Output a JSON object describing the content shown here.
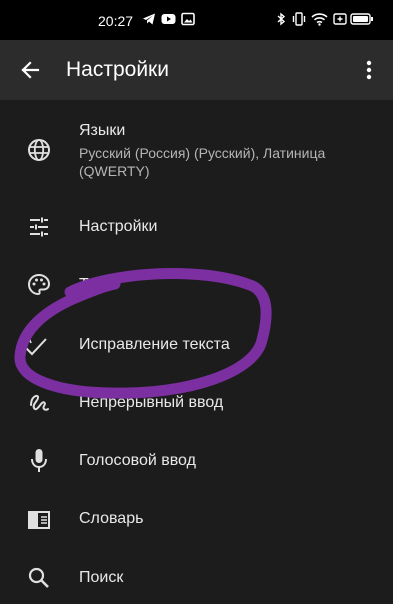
{
  "status_bar": {
    "time": "20:27",
    "icons": [
      "telegram-icon",
      "youtube-icon",
      "gallery-icon",
      "bluetooth-icon",
      "vibrate-icon",
      "wifi-icon",
      "battery-saver-icon",
      "battery-icon"
    ]
  },
  "header": {
    "title": "Настройки",
    "back_icon": "arrow-back-icon",
    "menu_icon": "more-vert-icon"
  },
  "items": [
    {
      "title": "Языки",
      "subtitle": "Русский (Россия) (Русский), Латиница (QWERTY)",
      "icon": "globe-icon"
    },
    {
      "title": "Настройки",
      "icon": "tune-icon"
    },
    {
      "title": "Тема",
      "icon": "palette-icon"
    },
    {
      "title": "Исправление текста",
      "icon": "spellcheck-icon"
    },
    {
      "title": "Непрерывный ввод",
      "icon": "gesture-icon"
    },
    {
      "title": "Голосовой ввод",
      "icon": "mic-icon"
    },
    {
      "title": "Словарь",
      "icon": "dictionary-icon"
    },
    {
      "title": "Поиск",
      "icon": "search-icon"
    }
  ],
  "annotation_color": "#7b2fa0"
}
